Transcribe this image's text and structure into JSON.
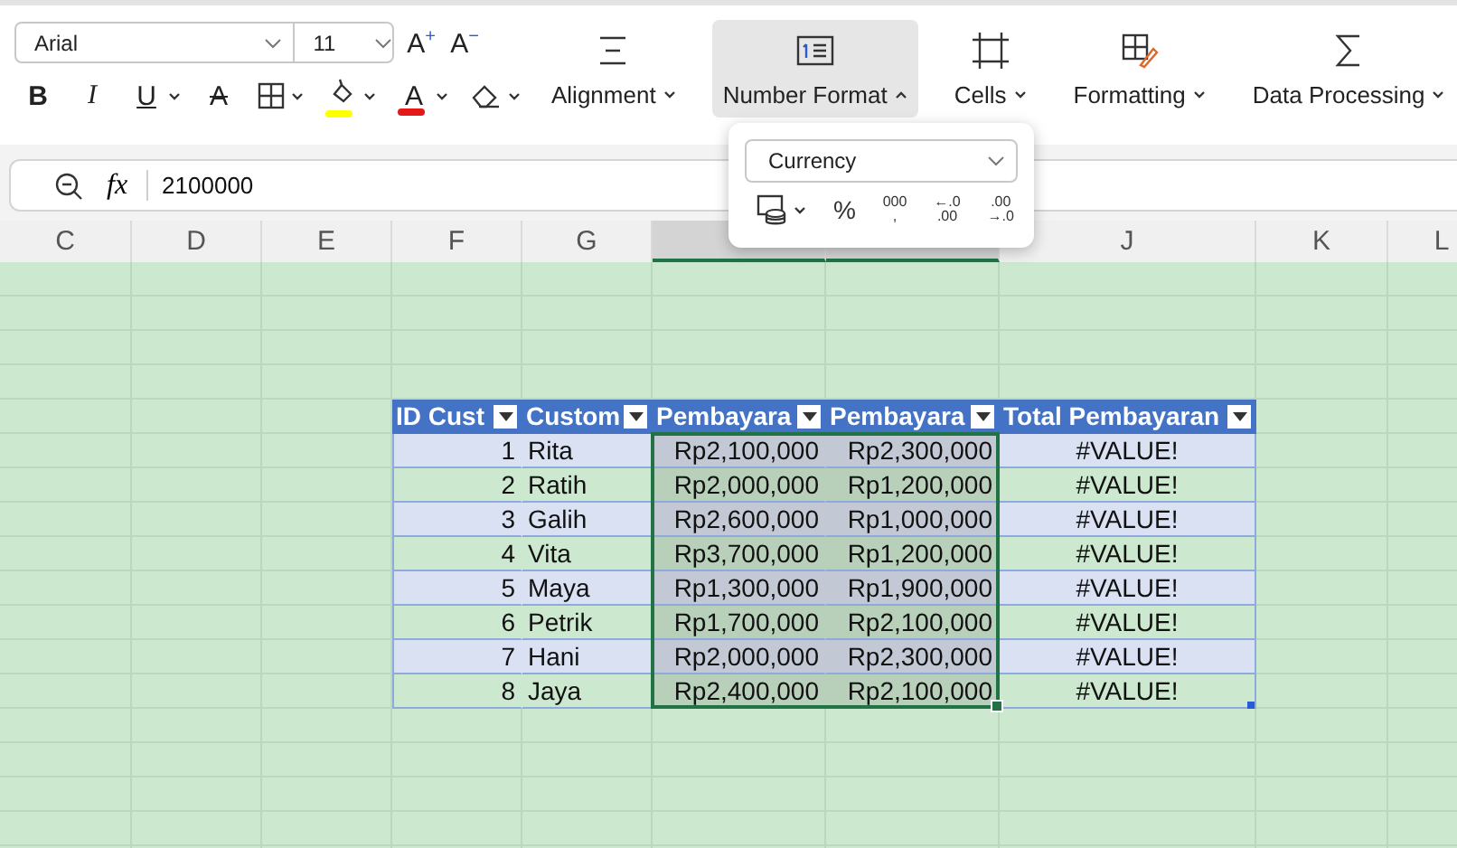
{
  "font_group": {
    "font": "Arial",
    "size": "11",
    "size_buttons": [
      {
        "text": "A$^{+}$"
      },
      {
        "text": "A$^{−}$"
      }
    ],
    "format_buttons": [
      {
        "kind": "bold",
        "text": "B"
      },
      {
        "kind": "italic",
        "text": "I"
      },
      {
        "kind": "underline",
        "text": "U"
      },
      {
        "kind": "strike",
        "text": "A"
      },
      {
        "kind": "borders"
      },
      {
        "kind": "highlight",
        "color": "#ffff00"
      },
      {
        "kind": "font_color",
        "text": "A",
        "color": "#e31919"
      },
      {
        "kind": "clear"
      }
    ]
  },
  "ribbon_groups": [
    {
      "kind": "alignment",
      "label": "Alignment",
      "expanded": false
    },
    {
      "kind": "number_format",
      "label": "Number Format",
      "expanded": true
    },
    {
      "kind": "cells",
      "label": "Cells",
      "expanded": false
    },
    {
      "kind": "formatting",
      "label": "Formatting",
      "expanded": false
    },
    {
      "kind": "data_processing",
      "label": "Data Processing",
      "expanded": false
    }
  ],
  "number_format_popup": {
    "format": "Currency",
    "buttons": [
      {
        "kind": "accounting"
      },
      {
        "kind": "percent",
        "lines": [
          "%"
        ]
      },
      {
        "kind": "comma",
        "lines": [
          "000",
          ","
        ]
      },
      {
        "kind": "decrease_decimal",
        "lines": [
          "←.0",
          ".00"
        ]
      },
      {
        "kind": "increase_decimal",
        "lines": [
          ".00",
          "→.0"
        ]
      }
    ]
  },
  "formula_bar": {
    "function_label": "fx",
    "value": "2100000"
  },
  "sheet": {
    "columns": [
      {
        "label": "C",
        "selected": false
      },
      {
        "label": "D",
        "selected": false
      },
      {
        "label": "E",
        "selected": false
      },
      {
        "label": "F",
        "selected": false
      },
      {
        "label": "G",
        "selected": false
      },
      {
        "selected": true
      },
      {
        "selected": true
      },
      {
        "label": "J",
        "selected": false
      },
      {
        "label": "K",
        "selected": false
      },
      {
        "label": "L",
        "selected": false
      }
    ],
    "table": {
      "columns": [
        {
          "label": "ID Cust",
          "kind": "number",
          "selected": false
        },
        {
          "label": "Custom",
          "kind": "text",
          "selected": false
        },
        {
          "label": "Pembayara",
          "kind": "number",
          "selected": true
        },
        {
          "label": "Pembayara",
          "kind": "number",
          "selected": true
        },
        {
          "label": "Total Pembayaran",
          "kind": "formula",
          "selected": false
        }
      ],
      "rows": [
        [
          "1",
          "Rita",
          "Rp2,100,000",
          "Rp2,300,000",
          "#VALUE!"
        ],
        [
          "2",
          "Ratih",
          "Rp2,000,000",
          "Rp1,200,000",
          "#VALUE!"
        ],
        [
          "3",
          "Galih",
          "Rp2,600,000",
          "Rp1,000,000",
          "#VALUE!"
        ],
        [
          "4",
          "Vita",
          "Rp3,700,000",
          "Rp1,200,000",
          "#VALUE!"
        ],
        [
          "5",
          "Maya",
          "Rp1,300,000",
          "Rp1,900,000",
          "#VALUE!"
        ],
        [
          "6",
          "Petrik",
          "Rp1,700,000",
          "Rp2,100,000",
          "#VALUE!"
        ],
        [
          "7",
          "Hani",
          "Rp2,000,000",
          "Rp2,300,000",
          "#VALUE!"
        ],
        [
          "8",
          "Jaya",
          "Rp2,400,000",
          "Rp2,100,000",
          "#VALUE!"
        ]
      ]
    }
  }
}
